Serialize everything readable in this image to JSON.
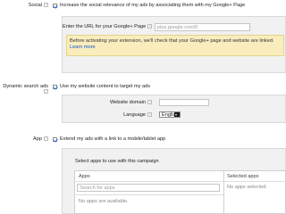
{
  "social": {
    "label": "Social",
    "checkbox_text": "Increase the social relevance of my ads by associating them with my Google+ Page",
    "url_label": "Enter the URL for your Google+ Page",
    "url_placeholder": "plus.google.com/0",
    "notice_text": "Before activating your extension, we'll check that your Google+ page and website are linked.",
    "notice_link": "Learn more"
  },
  "dynamic": {
    "label": "Dynamic search ads",
    "checkbox_text": "Use my website content to target my ads",
    "domain_label": "Website domain",
    "language_label": "Language",
    "language_value": "English"
  },
  "app": {
    "label": "App",
    "checkbox_text": "Extend my ads with a link to a mobile/tablet app",
    "select_prompt": "Select apps to use with this campaign",
    "apps_header": "Apps",
    "search_placeholder": "Search for apps",
    "no_apps": "No apps are available.",
    "selected_header": "Selected apps",
    "no_selected": "No apps selected."
  },
  "help_glyph": "?",
  "colors": {
    "panel_bg": "#f1f1f1",
    "notice_bg": "#f9edbe",
    "link": "#1155cc",
    "check": "#2a6fcf"
  }
}
